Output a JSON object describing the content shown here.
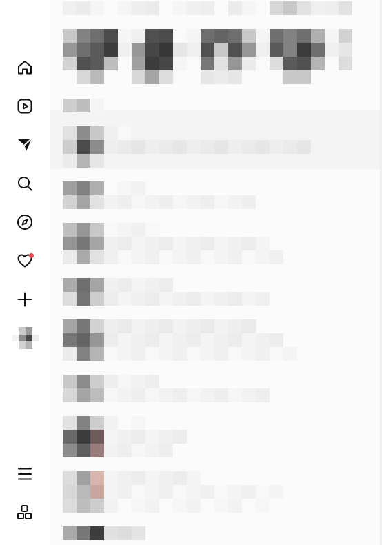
{
  "sidebar": {
    "items": [
      {
        "name": "nav-home",
        "icon": "home-icon"
      },
      {
        "name": "nav-reels",
        "icon": "reels-icon"
      },
      {
        "name": "nav-messages",
        "icon": "direct-icon"
      },
      {
        "name": "nav-search",
        "icon": "search-icon"
      },
      {
        "name": "nav-explore",
        "icon": "compass-icon"
      },
      {
        "name": "nav-notifications",
        "icon": "heart-icon",
        "has_badge": true
      },
      {
        "name": "nav-create",
        "icon": "plus-icon"
      },
      {
        "name": "nav-profile",
        "icon": "avatar"
      },
      {
        "name": "nav-more",
        "icon": "menu-icon"
      },
      {
        "name": "nav-also-from-meta",
        "icon": "grid-icon"
      }
    ]
  },
  "colors": {
    "icon": "#111111",
    "badge": "#e8434d",
    "background": "#ffffff"
  },
  "main": {
    "blurred": true
  }
}
